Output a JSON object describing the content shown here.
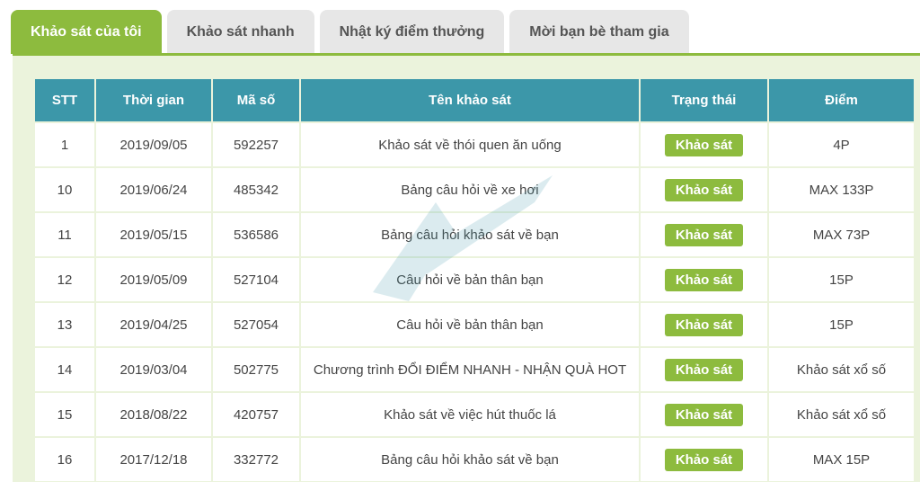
{
  "tabs": [
    {
      "label": "Khảo sát của tôi",
      "active": true
    },
    {
      "label": "Khảo sát nhanh",
      "active": false
    },
    {
      "label": "Nhật ký điểm thưởng",
      "active": false
    },
    {
      "label": "Mời bạn bè tham gia",
      "active": false
    }
  ],
  "table": {
    "headers": [
      "STT",
      "Thời gian",
      "Mã số",
      "Tên khảo sát",
      "Trạng thái",
      "Điểm"
    ],
    "rows": [
      {
        "stt": "1",
        "date": "2019/09/05",
        "code": "592257",
        "name": "Khảo sát về thói quen ăn uống",
        "status": "Khảo sát",
        "points": "4P"
      },
      {
        "stt": "10",
        "date": "2019/06/24",
        "code": "485342",
        "name": "Bảng câu hỏi về xe hơi",
        "status": "Khảo sát",
        "points": "MAX 133P"
      },
      {
        "stt": "11",
        "date": "2019/05/15",
        "code": "536586",
        "name": "Bảng câu hỏi khảo sát về bạn",
        "status": "Khảo sát",
        "points": "MAX 73P"
      },
      {
        "stt": "12",
        "date": "2019/05/09",
        "code": "527104",
        "name": "Câu hỏi về bản thân bạn",
        "status": "Khảo sát",
        "points": "15P"
      },
      {
        "stt": "13",
        "date": "2019/04/25",
        "code": "527054",
        "name": "Câu hỏi về bản thân bạn",
        "status": "Khảo sát",
        "points": "15P"
      },
      {
        "stt": "14",
        "date": "2019/03/04",
        "code": "502775",
        "name": "Chương trình ĐỔI ĐIỂM NHANH - NHẬN QUÀ HOT",
        "status": "Khảo sát",
        "points": "Khảo sát xổ số"
      },
      {
        "stt": "15",
        "date": "2018/08/22",
        "code": "420757",
        "name": "Khảo sát về việc hút thuốc lá",
        "status": "Khảo sát",
        "points": "Khảo sát xổ số"
      },
      {
        "stt": "16",
        "date": "2017/12/18",
        "code": "332772",
        "name": "Bảng câu hỏi khảo sát về bạn",
        "status": "Khảo sát",
        "points": "MAX 15P"
      }
    ]
  },
  "colors": {
    "accent_green": "#8dbb3e",
    "header_teal": "#3c97a9",
    "panel_bg": "#ebf3dc",
    "tab_inactive": "#e7e7e7"
  }
}
